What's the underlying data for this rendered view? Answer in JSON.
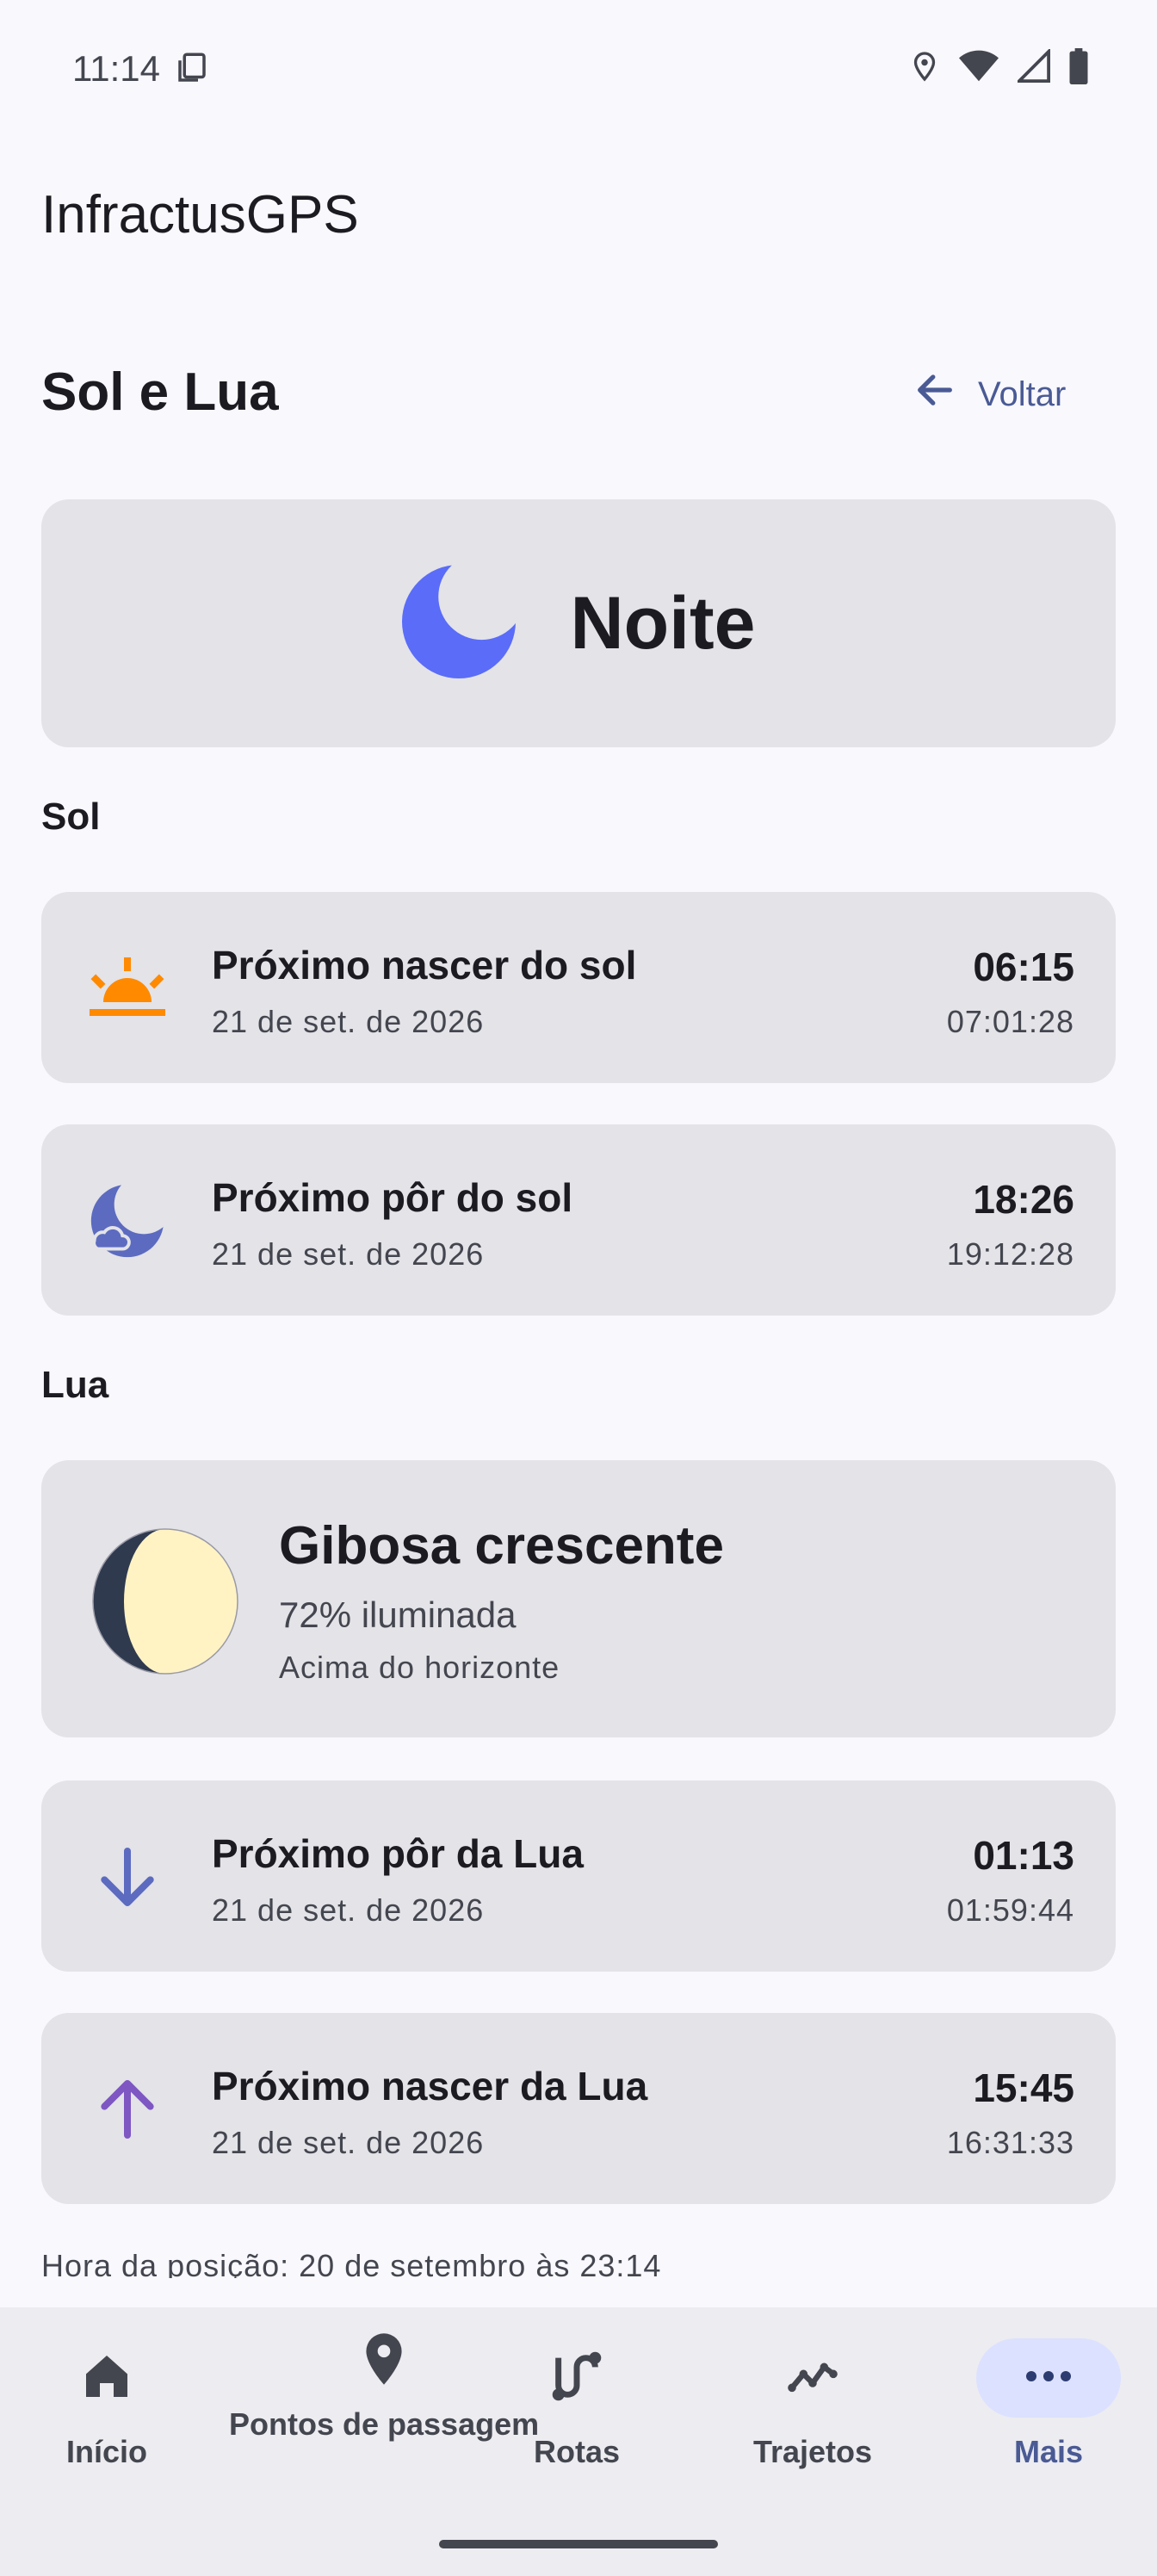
{
  "status_bar": {
    "time": "11:14"
  },
  "app": {
    "title": "InfractusGPS"
  },
  "header": {
    "page_title": "Sol e Lua",
    "back_label": "Voltar"
  },
  "hero": {
    "label": "Noite"
  },
  "sun_section": {
    "label": "Sol",
    "rows": [
      {
        "title": "Próximo nascer do sol",
        "date": "21 de set. de 2026",
        "time": "06:15",
        "secondary_time": "07:01:28",
        "icon": "sunrise-icon"
      },
      {
        "title": "Próximo pôr do sol",
        "date": "21 de set. de 2026",
        "time": "18:26",
        "secondary_time": "19:12:28",
        "icon": "night-moon-icon"
      }
    ]
  },
  "moon_section": {
    "label": "Lua",
    "phase": {
      "name": "Gibosa crescente",
      "illumination": "72% iluminada",
      "horizon": "Acima do horizonte",
      "illuminated_fraction": 0.72
    },
    "rows": [
      {
        "title": "Próximo pôr da Lua",
        "date": "21 de set. de 2026",
        "time": "01:13",
        "secondary_time": "01:59:44",
        "icon": "arrow-down-icon"
      },
      {
        "title": "Próximo nascer da Lua",
        "date": "21 de set. de 2026",
        "time": "15:45",
        "secondary_time": "16:31:33",
        "icon": "arrow-up-icon"
      }
    ]
  },
  "footer": {
    "note": "Hora da posição: 20 de setembro às 23:14"
  },
  "nav": {
    "items": [
      {
        "label": "Início",
        "icon": "home-icon"
      },
      {
        "label": "Pontos de passagem",
        "icon": "location-pin-icon"
      },
      {
        "label": "Rotas",
        "icon": "route-icon"
      },
      {
        "label": "Trajetos",
        "icon": "trajectory-icon"
      },
      {
        "label": "Mais",
        "icon": "more-icon",
        "active": true
      }
    ]
  },
  "colors": {
    "accent": "#4a5a94",
    "moon_icon": "#5a6cf8",
    "sunrise": "#ff8a00",
    "moon_light": "#fff3c4",
    "moon_dark": "#2f3a4f",
    "arrow_down": "#5c6bc0",
    "arrow_up": "#7e57c2"
  }
}
